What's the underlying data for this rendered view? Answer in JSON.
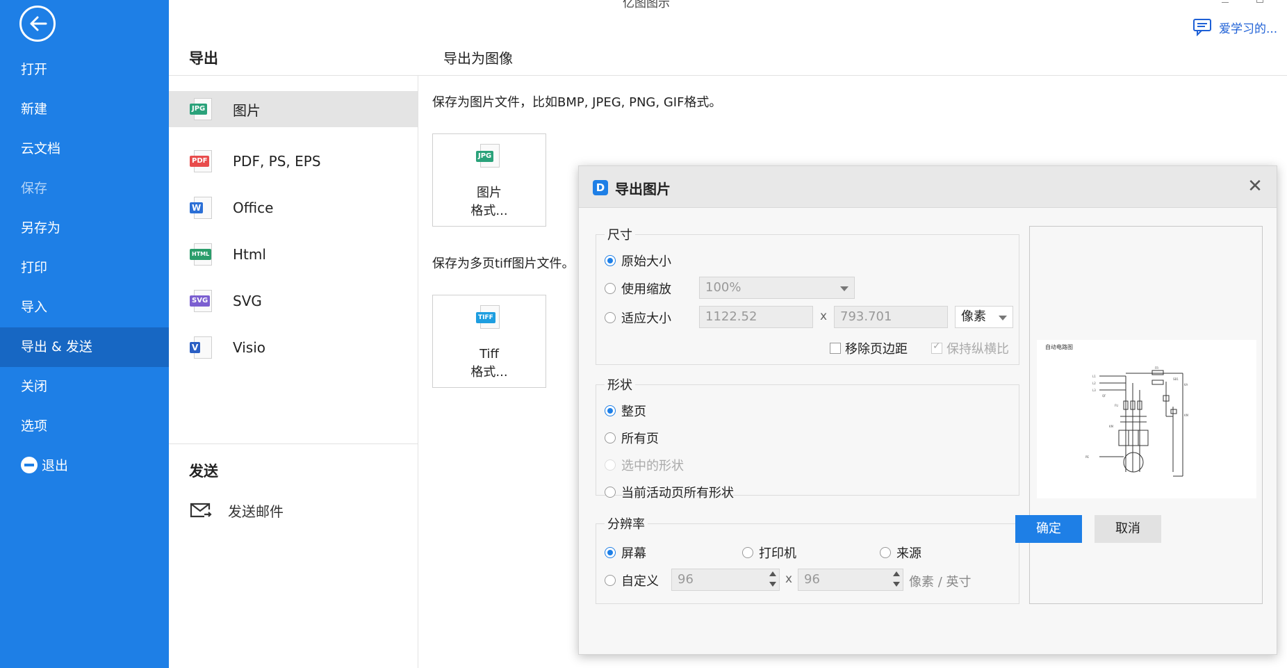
{
  "app": {
    "title": "亿图图示",
    "user": "爱学习的..."
  },
  "sidebar": {
    "items": [
      {
        "label": "打开"
      },
      {
        "label": "新建"
      },
      {
        "label": "云文档"
      },
      {
        "label": "保存"
      },
      {
        "label": "另存为"
      },
      {
        "label": "打印"
      },
      {
        "label": "导入"
      },
      {
        "label": "导出 & 发送"
      },
      {
        "label": "关闭"
      },
      {
        "label": "选项"
      },
      {
        "label": "退出"
      }
    ]
  },
  "export": {
    "header": "导出",
    "formats": [
      {
        "label": "图片",
        "tag": "JPG",
        "color": "#2aa27a"
      },
      {
        "label": "PDF, PS, EPS",
        "tag": "PDF",
        "color": "#e84c4c"
      },
      {
        "label": "Office",
        "tag": "W",
        "color": "#2b6fd6"
      },
      {
        "label": "Html",
        "tag": "HTML",
        "color": "#2a9d6b"
      },
      {
        "label": "SVG",
        "tag": "SVG",
        "color": "#7b5fd0"
      },
      {
        "label": "Visio",
        "tag": "V",
        "color": "#2b5fc4"
      }
    ],
    "send_header": "发送",
    "send_mail": "发送邮件"
  },
  "content": {
    "section_title": "导出为图像",
    "desc_image": "保存为图片文件，比如BMP, JPEG, PNG, GIF格式。",
    "card_image": {
      "line1": "图片",
      "line2": "格式...",
      "tag": "JPG"
    },
    "desc_tiff": "保存为多页tiff图片文件。",
    "card_tiff": {
      "line1": "Tiff",
      "line2": "格式...",
      "tag": "TIFF"
    }
  },
  "dialog": {
    "logo": "D",
    "title": "导出图片",
    "close": "✕",
    "size": {
      "title": "尺寸",
      "original": "原始大小",
      "use_zoom": "使用缩放",
      "zoom_value": "100%",
      "fit": "适应大小",
      "width": "1122.52",
      "height": "793.701",
      "unit": "像素",
      "x": "x",
      "remove_margin": "移除页边距",
      "keep_ratio": "保持纵横比"
    },
    "shape": {
      "title": "形状",
      "whole_page": "整页",
      "all_pages": "所有页",
      "selected": "选中的形状",
      "current_all": "当前活动页所有形状"
    },
    "resolution": {
      "title": "分辨率",
      "screen": "屏幕",
      "printer": "打印机",
      "source": "来源",
      "custom": "自定义",
      "dpi_x": "96",
      "dpi_y": "96",
      "unit": "像素 / 英寸"
    },
    "preview": {
      "page_title": "自动电路图"
    },
    "ok": "确定",
    "cancel": "取消"
  }
}
